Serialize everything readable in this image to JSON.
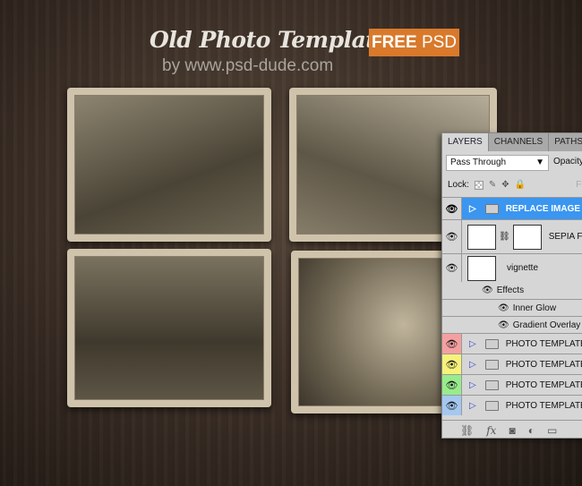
{
  "header": {
    "title": "Old Photo Template",
    "byline": "by www.psd-dude.com",
    "badge_bold": "FREE",
    "badge_rest": "PSD",
    "badge_color": "#d9792b"
  },
  "panel": {
    "tabs": [
      "LAYERS",
      "CHANNELS",
      "PATHS"
    ],
    "blend_mode": "Pass Through",
    "opacity_label": "Opacity",
    "lock_label": "Lock:",
    "fill_label": "Fi",
    "layers": [
      {
        "name": "REPLACE IMAGE",
        "type": "group",
        "selected": true
      },
      {
        "name": "SEPIA FI",
        "type": "adjustment"
      },
      {
        "name": "vignette",
        "type": "layer"
      },
      {
        "name": "Effects",
        "type": "effects"
      },
      {
        "name": "Inner Glow",
        "type": "effect"
      },
      {
        "name": "Gradient Overlay",
        "type": "effect"
      },
      {
        "name": "PHOTO TEMPLATE",
        "type": "group",
        "color": "#f4a0a0"
      },
      {
        "name": "PHOTO TEMPLATE",
        "type": "group",
        "color": "#f6f27a"
      },
      {
        "name": "PHOTO TEMPLATE",
        "type": "group",
        "color": "#98ec8c"
      },
      {
        "name": "PHOTO TEMPLATE",
        "type": "group",
        "color": "#a4c8f0"
      }
    ],
    "footer_icons": [
      "link-icon",
      "fx-icon",
      "mask-icon",
      "adjustment-icon",
      "new-group-icon"
    ]
  }
}
